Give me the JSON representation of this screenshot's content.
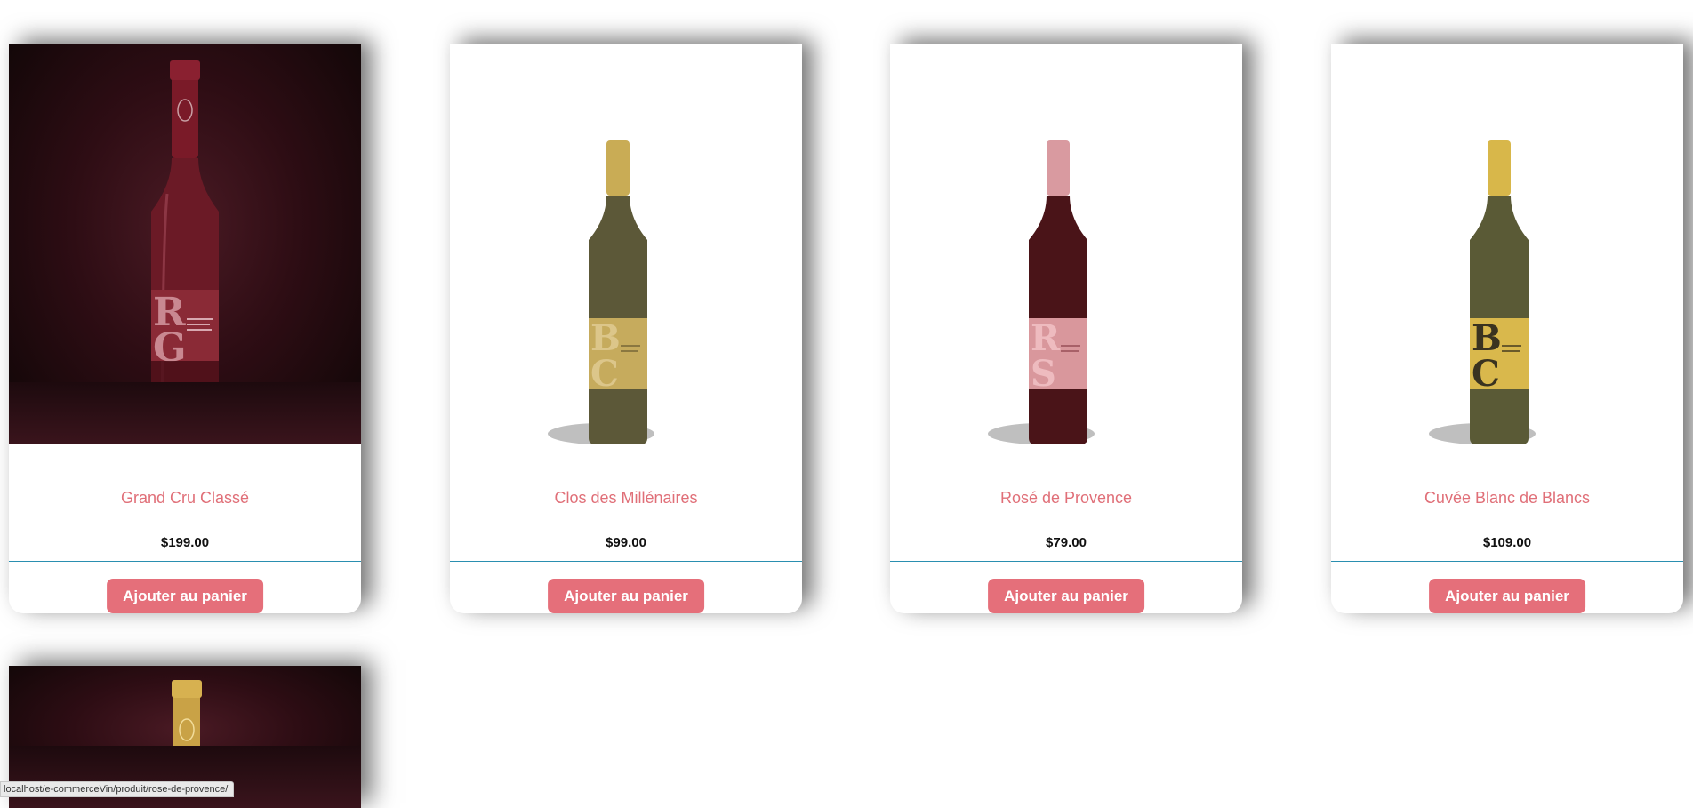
{
  "products": [
    {
      "name": "Grand Cru Classé",
      "price": "$199.00",
      "button": "Ajouter au panier",
      "label_letters": "RG"
    },
    {
      "name": "Clos des Millénaires",
      "price": "$99.00",
      "button": "Ajouter au panier",
      "label_letters": "BC"
    },
    {
      "name": "Rosé de Provence",
      "price": "$79.00",
      "button": "Ajouter au panier",
      "label_letters": "RS"
    },
    {
      "name": "Cuvée Blanc de Blancs",
      "price": "$109.00",
      "button": "Ajouter au panier",
      "label_letters": "BC"
    }
  ],
  "status_bar": {
    "url": "localhost/e-commerceVin/produit/rose-de-provence/"
  },
  "colors": {
    "accent": "#e56f7a",
    "name_text": "#e06f78",
    "divider": "#2a8fb0"
  }
}
